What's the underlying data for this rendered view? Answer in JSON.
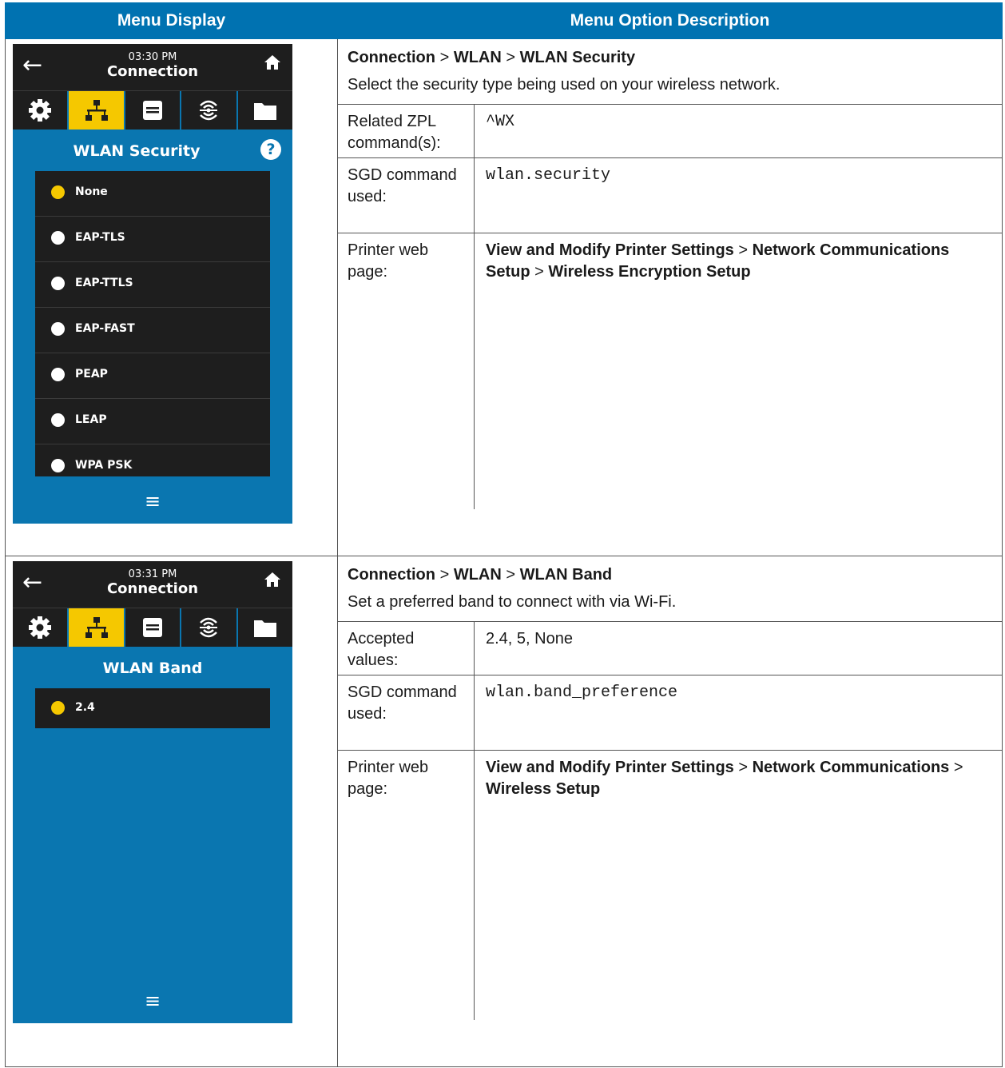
{
  "headers": {
    "col1": "Menu Display",
    "col2": "Menu Option Description"
  },
  "rows": [
    {
      "screen": {
        "time": "03:30 PM",
        "title": "Connection",
        "section": "WLAN Security",
        "help_icon": "?",
        "options": [
          {
            "label": "None",
            "selected": true
          },
          {
            "label": "EAP-TLS",
            "selected": false
          },
          {
            "label": "EAP-TTLS",
            "selected": false
          },
          {
            "label": "EAP-FAST",
            "selected": false
          },
          {
            "label": "PEAP",
            "selected": false
          },
          {
            "label": "LEAP",
            "selected": false
          },
          {
            "label": "WPA PSK",
            "selected": false
          }
        ]
      },
      "path": [
        "Connection",
        ">",
        "WLAN",
        ">",
        "WLAN Security"
      ],
      "summary": "Select the security type being used on your wireless network.",
      "details": [
        {
          "label": "Related ZPL command(s):",
          "value": "^WX"
        },
        {
          "label": "SGD command used:",
          "value": "wlan.security"
        },
        {
          "label": "Printer web page:",
          "value_parts": [
            "View and Modify Printer Settings",
            ">",
            "Network Communications Setup",
            ">",
            "Wireless Encryption Setup"
          ]
        }
      ]
    },
    {
      "screen": {
        "time": "03:31 PM",
        "title": "Connection",
        "section": "WLAN Band",
        "options": [
          {
            "label": "2.4",
            "selected": true
          }
        ]
      },
      "path": [
        "Connection",
        ">",
        "WLAN",
        ">",
        "WLAN Band"
      ],
      "summary": "Set a preferred band to connect with via Wi-Fi.",
      "details": [
        {
          "label": "Accepted values:",
          "value": "2.4, 5, None"
        },
        {
          "label": "SGD command used:",
          "value": "wlan.band_preference"
        },
        {
          "label": "Printer web page:",
          "value_parts": [
            "View and Modify Printer Settings",
            ">",
            "Network Communications",
            ">",
            "Wireless Setup"
          ]
        }
      ]
    }
  ],
  "colors": {
    "header": "#0072b1",
    "screen_bg": "#0a76b0",
    "active_tab": "#f5c800",
    "selected_dot": "#f5c800"
  },
  "icons": [
    "back-arrow-icon",
    "home-icon",
    "gear-icon",
    "network-icon",
    "printer-icon",
    "wireless-icon",
    "folder-icon",
    "help-icon",
    "menu-icon"
  ]
}
